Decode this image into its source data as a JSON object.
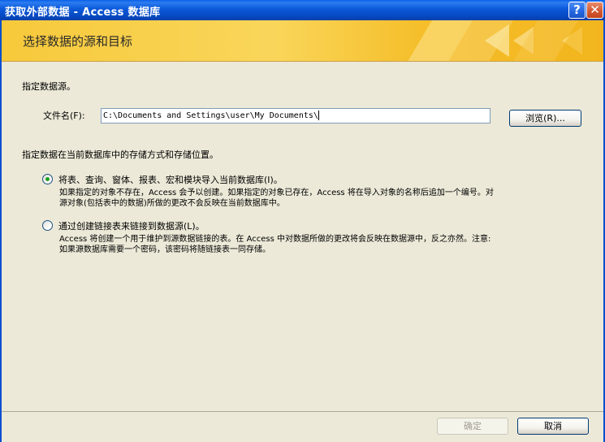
{
  "window": {
    "title": "获取外部数据 - Access 数据库",
    "help_label": "?",
    "close_label": "✕"
  },
  "banner": {
    "title": "选择数据的源和目标"
  },
  "source": {
    "heading": "指定数据源。",
    "file_label": "文件名(F):",
    "file_value": "C:\\Documents and Settings\\user\\My Documents\\",
    "browse_label": "浏览(R)..."
  },
  "storage": {
    "heading": "指定数据在当前数据库中的存储方式和存储位置。",
    "option_import": {
      "label": "将表、查询、窗体、报表、宏和模块导入当前数据库(I)。",
      "desc_line1": "如果指定的对象不存在，Access 会予以创建。如果指定的对象已存在，Access 将在导入对象的名称后追加一个编号。对",
      "desc_line2": "源对象(包括表中的数据)所做的更改不会反映在当前数据库中。",
      "checked": true
    },
    "option_link": {
      "label": "通过创建链接表来链接到数据源(L)。",
      "desc_line1": "Access 将创建一个用于维护到源数据链接的表。在 Access 中对数据所做的更改将会反映在数据源中，反之亦然。注意:",
      "desc_line2": "如果源数据库需要一个密码，该密码将随链接表一同存储。",
      "checked": false
    }
  },
  "footer": {
    "ok_label": "确定",
    "cancel_label": "取消"
  },
  "colors": {
    "titlebar": "#0A5FE8",
    "banner": "#F7C93B",
    "dialog_bg": "#ECE9D8",
    "radio_dot": "#21A121"
  }
}
